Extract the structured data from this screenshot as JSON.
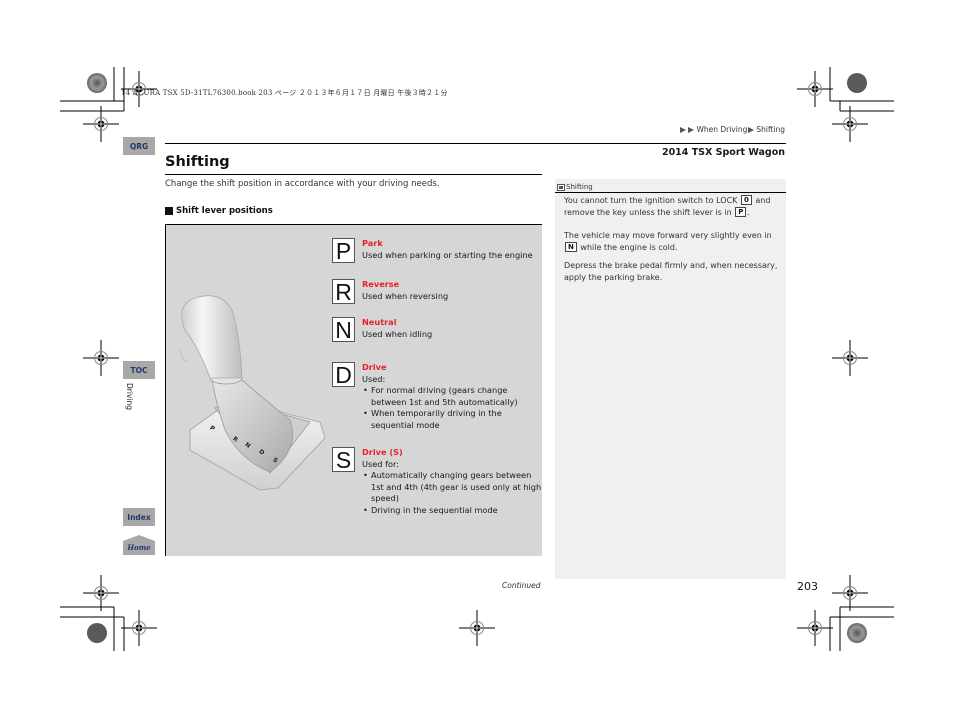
{
  "print_header": "14 ACURA TSX 5D-31TL76300.book  203 ページ  ２０１３年６月１７日  月曜日  午後３時２１分",
  "breadcrumb": {
    "items": [
      "When Driving",
      "Shifting"
    ]
  },
  "model_name": "2014 TSX Sport Wagon",
  "side_nav": {
    "qrg": "QRG",
    "toc": "TOC",
    "section": "Driving",
    "index": "Index",
    "home": "Home"
  },
  "page": {
    "title": "Shifting",
    "intro": "Change the shift position in accordance with your driving needs.",
    "section_heading": "Shift lever positions"
  },
  "gears": [
    {
      "letter": "P",
      "name": "Park",
      "desc": "Used when parking or starting the engine",
      "bullets": []
    },
    {
      "letter": "R",
      "name": "Reverse",
      "desc": "Used when reversing",
      "bullets": []
    },
    {
      "letter": "N",
      "name": "Neutral",
      "desc": "Used when idling",
      "bullets": []
    },
    {
      "letter": "D",
      "name": "Drive",
      "desc": "Used:",
      "bullets": [
        "For normal driving (gears change between 1st and 5th automatically)",
        "When temporarily driving in the sequential mode"
      ]
    },
    {
      "letter": "S",
      "name": "Drive (S)",
      "desc": "Used for:",
      "bullets": [
        "Automatically changing gears between 1st and 4th (4th gear is used only at high speed)",
        "Driving in the sequential mode"
      ]
    }
  ],
  "illustration": {
    "gate_labels": [
      "P",
      "R",
      "N",
      "D",
      "S"
    ]
  },
  "note": {
    "heading": "Shifting",
    "p1_a": "You cannot turn the ignition switch to LOCK ",
    "p1_key1": "0",
    "p1_b": " and remove the key unless the shift lever is in ",
    "p1_key2": "P",
    "p1_c": ".",
    "p2_key": "N",
    "p2_a": "The vehicle may move forward very slightly even in ",
    "p2_b": " while the engine is cold.",
    "p3": "Depress the brake pedal firmly and, when necessary, apply the parking brake."
  },
  "footer": {
    "continued": "Continued",
    "page_number": "203"
  },
  "colors": {
    "gear_name": "#e8202a",
    "side_tab_bg": "#a8a8a8",
    "side_tab_text": "#1e3a6a",
    "figure_bg": "#d6d6d6",
    "note_bg": "#f0f0f0"
  }
}
